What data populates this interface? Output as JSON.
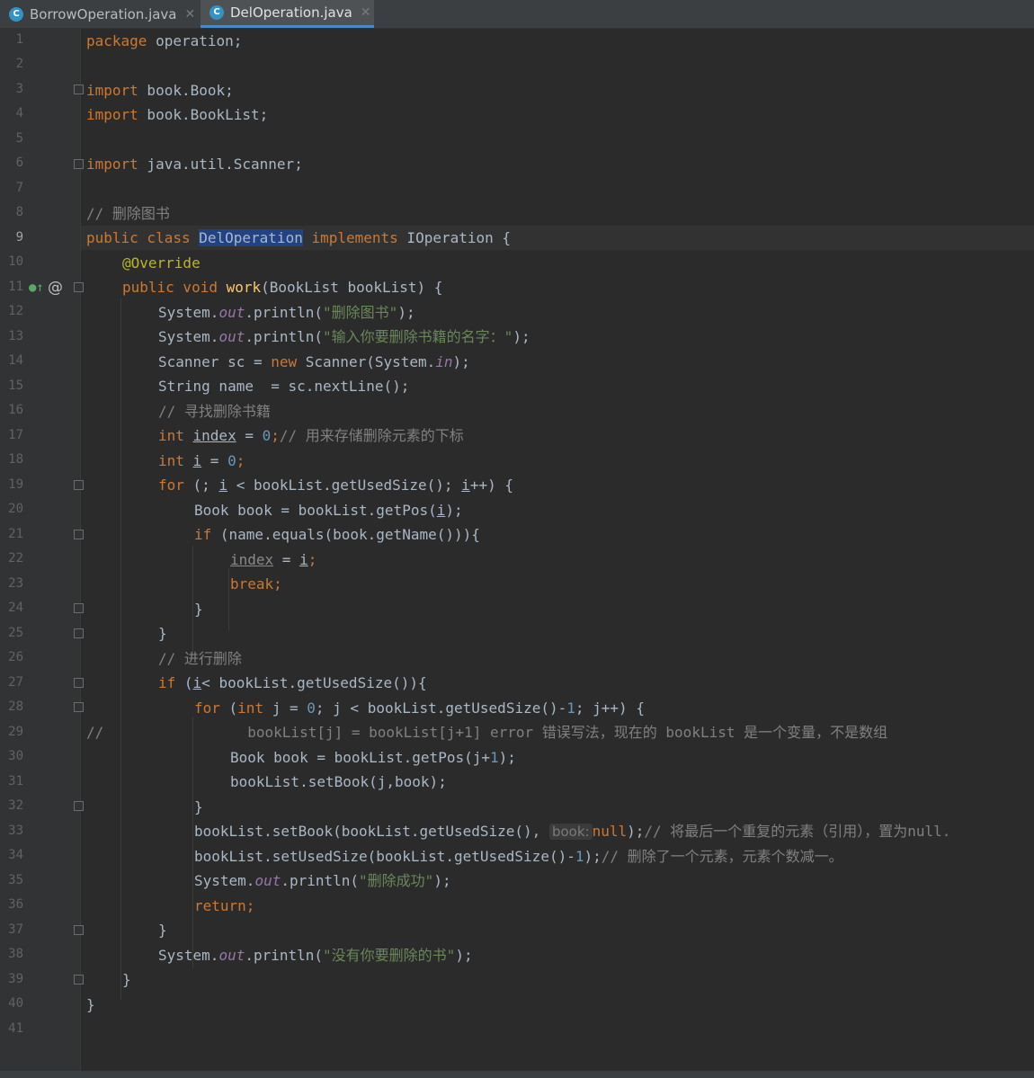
{
  "tabs": [
    {
      "label": "BorrowOperation.java",
      "icon": "java-class-icon",
      "active": false
    },
    {
      "label": "DelOperation.java",
      "icon": "java-class-icon",
      "active": true
    }
  ],
  "colors": {
    "background": "#2b2b2b",
    "keyword": "#cc7832",
    "method": "#ffc66d",
    "string": "#6a8759",
    "comment": "#808080",
    "number": "#6897bb",
    "annotation": "#bbb529",
    "selection": "#214283"
  },
  "line_numbers": [
    "1",
    "2",
    "3",
    "4",
    "5",
    "6",
    "7",
    "8",
    "9",
    "10",
    "11",
    "12",
    "13",
    "14",
    "15",
    "16",
    "17",
    "18",
    "19",
    "20",
    "21",
    "22",
    "23",
    "24",
    "25",
    "26",
    "27",
    "28",
    "29",
    "30",
    "31",
    "32",
    "33",
    "34",
    "35",
    "36",
    "37",
    "38",
    "39",
    "40",
    "41"
  ],
  "current_line": "9",
  "code": {
    "l1": {
      "kw1": "package",
      "rest": " operation;"
    },
    "l3": {
      "kw": "import",
      "rest": " book.Book;"
    },
    "l4": {
      "kw": "import",
      "rest": " book.BookList;"
    },
    "l6": {
      "kw": "import",
      "rest": " java.util.Scanner;"
    },
    "l8": {
      "comment": "// 删除图书"
    },
    "l9": {
      "kw1": "public class ",
      "cls": "DelOperation",
      "kw2": " implements",
      "rest": " IOperation {"
    },
    "l10": {
      "ann": "@Override"
    },
    "l11": {
      "kw": "public void ",
      "fn": "work",
      "rest": "(BookList bookList) {"
    },
    "l12": {
      "a": "System.",
      "st": "out",
      "b": ".println(",
      "str": "\"删除图书\"",
      "c": ");"
    },
    "l13": {
      "a": "System.",
      "st": "out",
      "b": ".println(",
      "str": "\"输入你要删除书籍的名字：\"",
      "c": ");"
    },
    "l14": {
      "a": "Scanner sc = ",
      "kw": "new",
      "b": " Scanner(System.",
      "st": "in",
      "c": ");"
    },
    "l15": {
      "a": "String name  = sc.nextLine();"
    },
    "l16": {
      "comment": "// 寻找删除书籍"
    },
    "l17": {
      "kw": "int ",
      "var": "index",
      "a": " = ",
      "num": "0",
      "b": ";",
      "comment": "// 用来存储删除元素的下标"
    },
    "l18": {
      "kw": "int ",
      "var": "i",
      "a": " = ",
      "num": "0",
      "b": ";"
    },
    "l19": {
      "kw": "for",
      "a": " (; ",
      "var": "i",
      "b": " < bookList.getUsedSize(); ",
      "var2": "i",
      "c": "++) {"
    },
    "l20": {
      "a": "Book book = bookList.getPos(",
      "var": "i",
      "b": ");"
    },
    "l21": {
      "kw": "if",
      "a": " (name.equals(book.getName())){"
    },
    "l22": {
      "var": "index",
      "a": " = ",
      "var2": "i",
      "b": ";"
    },
    "l23": {
      "kw": "break",
      "a": ";"
    },
    "l24": {
      "a": "}"
    },
    "l25": {
      "a": "}"
    },
    "l26": {
      "comment": "// 进行删除"
    },
    "l27": {
      "kw": "if",
      "a": " (",
      "var": "i",
      "b": "< bookList.getUsedSize()){"
    },
    "l28": {
      "kw": "for",
      "a": " (",
      "kw2": "int",
      "b": " j = ",
      "num": "0",
      "c": "; j < bookList.getUsedSize()-",
      "num2": "1",
      "d": "; j++) {"
    },
    "l29": {
      "slashes": "//",
      "rest": "bookList[j] = bookList[j+1] error 错误写法，现在的 bookList 是一个变量，不是数组"
    },
    "l30": {
      "a": "Book book = bookList.getPos(j+",
      "num": "1",
      "b": ");"
    },
    "l31": {
      "a": "bookList.setBook(j,book);"
    },
    "l32": {
      "a": "}"
    },
    "l33": {
      "a": "bookList.setBook(bookList.getUsedSize(), ",
      "hint": "book:",
      "kw": "null",
      "b": ");",
      "comment": "// 将最后一个重复的元素（引用），置为null."
    },
    "l34": {
      "a": "bookList.setUsedSize(bookList.getUsedSize()-",
      "num": "1",
      "b": ");",
      "comment": "// 删除了一个元素，元素个数减一。"
    },
    "l35": {
      "a": "System.",
      "st": "out",
      "b": ".println(",
      "str": "\"删除成功\"",
      "c": ");"
    },
    "l36": {
      "kw": "return",
      "a": ";"
    },
    "l37": {
      "a": "}"
    },
    "l38": {
      "a": "System.",
      "st": "out",
      "b": ".println(",
      "str": "\"没有你要删除的书\"",
      "c": ");"
    },
    "l39": {
      "a": "}"
    },
    "l40": {
      "a": "}"
    }
  },
  "gutter_icons": {
    "implements": "implements-method-icon",
    "override": "annotation-at-icon"
  }
}
